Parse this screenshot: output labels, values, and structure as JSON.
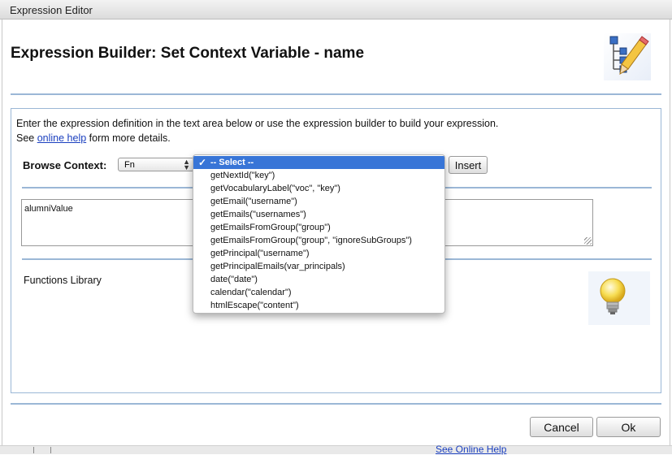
{
  "window": {
    "title": "Expression Editor"
  },
  "header": {
    "title": "Expression Builder: Set Context Variable - name"
  },
  "intro": {
    "line1": "Enter the expression definition in the text area below or use the expression builder to build your expression.",
    "see": "See ",
    "link_text": "online help",
    "after_link": " form more details."
  },
  "browse": {
    "label": "Browse Context:",
    "selected": "Fn",
    "insert_label": "Insert"
  },
  "dropdown": {
    "options": [
      "-- Select --",
      "getNextId(\"key\")",
      "getVocabularyLabel(\"voc\", \"key\")",
      "getEmail(\"username\")",
      "getEmails(\"usernames\")",
      "getEmailsFromGroup(\"group\")",
      "getEmailsFromGroup(\"group\", \"ignoreSubGroups\")",
      "getPrincipal(\"username\")",
      "getPrincipalEmails(var_principals)",
      "date(\"date\")",
      "calendar(\"calendar\")",
      "htmlEscape(\"content\")"
    ],
    "selected_index": 0
  },
  "expression": {
    "value": "alumniValue"
  },
  "functions": {
    "label": "Functions Library"
  },
  "footer": {
    "cancel_label": "Cancel",
    "ok_label": "Ok"
  },
  "background": {
    "link_text": "See Online Help"
  },
  "colors": {
    "accent_rule": "#9bb7d6",
    "selection": "#3875d7",
    "link": "#1a3fbf"
  }
}
